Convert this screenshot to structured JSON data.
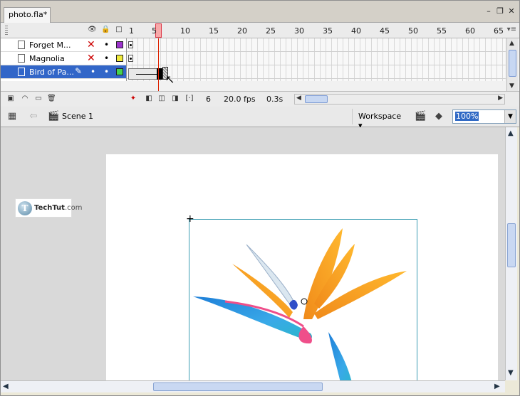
{
  "document": {
    "tab_title": "photo.fla*"
  },
  "window_controls": {
    "minimize": "–",
    "restore": "❐",
    "close": "✕"
  },
  "timeline": {
    "header_icons": {
      "eye": "👁",
      "lock": "🔒",
      "outline": "□"
    },
    "ruler_numbers": [
      "1",
      "5",
      "10",
      "15",
      "20",
      "25",
      "30",
      "35",
      "40",
      "45",
      "50",
      "55",
      "60",
      "65"
    ],
    "layers": [
      {
        "name": "Forget M...",
        "swatch_color": "#9c33cc",
        "selected": false
      },
      {
        "name": "Magnolia",
        "swatch_color": "#f0ea3a",
        "selected": false
      },
      {
        "name": "Bird of Pa...",
        "swatch_color": "#45d34f",
        "selected": true
      }
    ],
    "status": {
      "current_frame": "6",
      "fps": "20.0 fps",
      "time": "0.3s"
    },
    "current_frame_number": 6
  },
  "editbar": {
    "scene_label": "Scene 1",
    "workspace_label": "Workspace ▾",
    "zoom_value": "100%"
  },
  "stage": {
    "logo": {
      "letter": "T",
      "name": "TechTut",
      "suffix": ".com"
    }
  },
  "colors": {
    "selection": "#3266c8",
    "playhead": "#dd2200",
    "bitmap_border": "#3c9db3"
  }
}
